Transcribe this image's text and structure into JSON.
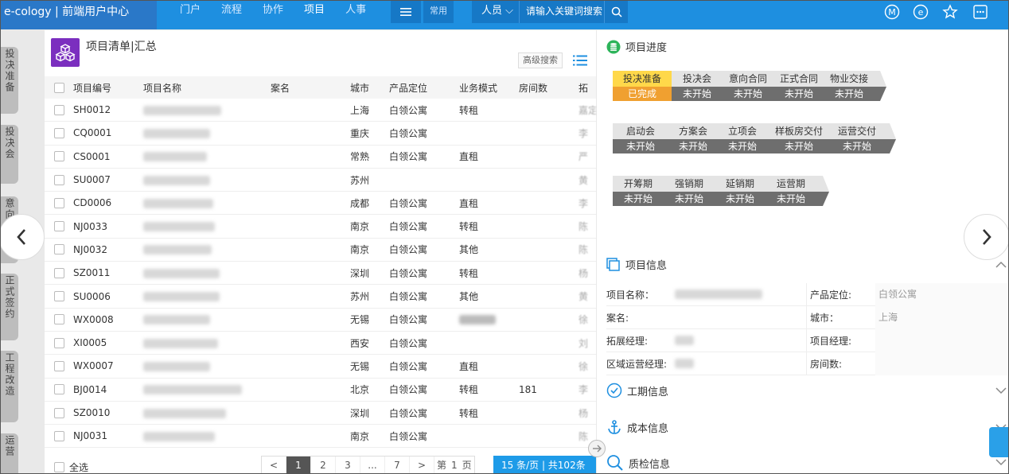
{
  "topbar": {
    "brand": "e-cology | 前端用户中心",
    "nav": [
      "门户",
      "流程",
      "协作",
      "项目",
      "人事"
    ],
    "active_nav": "项目",
    "common": "常用",
    "search_scope": "人员",
    "search_placeholder": "请输入关键词搜索"
  },
  "rail_tabs": [
    {
      "label": "投决准备"
    },
    {
      "label": "投决会"
    },
    {
      "label": "意向签约"
    },
    {
      "label": "正式签约"
    },
    {
      "label": "工程改造"
    },
    {
      "label": "运营"
    }
  ],
  "left": {
    "title": "项目清单|汇总",
    "adv_search": "高级搜索",
    "headers": [
      "项目编号",
      "项目名称",
      "案名",
      "城市",
      "产品定位",
      "业务模式",
      "房间数",
      "拓"
    ],
    "rows": [
      {
        "code": "SH0012",
        "city": "上海",
        "prod": "白领公寓",
        "mode": "转租",
        "rooms": "",
        "ext": "嘉定"
      },
      {
        "code": "CQ0001",
        "city": "重庆",
        "prod": "白领公寓",
        "mode": "",
        "rooms": "",
        "ext": "李"
      },
      {
        "code": "CS0001",
        "city": "常熟",
        "prod": "白领公寓",
        "mode": "直租",
        "rooms": "",
        "ext": "严"
      },
      {
        "code": "SU0007",
        "city": "苏州",
        "prod": "",
        "mode": "",
        "rooms": "",
        "ext": "黄"
      },
      {
        "code": "CD0006",
        "city": "成都",
        "prod": "白领公寓",
        "mode": "直租",
        "rooms": "",
        "ext": "李"
      },
      {
        "code": "NJ0033",
        "city": "南京",
        "prod": "白领公寓",
        "mode": "转租",
        "rooms": "",
        "ext": "陈"
      },
      {
        "code": "NJ0032",
        "city": "南京",
        "prod": "白领公寓",
        "mode": "其他",
        "rooms": "",
        "ext": "陈"
      },
      {
        "code": "SZ0011",
        "city": "深圳",
        "prod": "白领公寓",
        "mode": "转租",
        "rooms": "",
        "ext": "杨"
      },
      {
        "code": "SU0006",
        "city": "苏州",
        "prod": "白领公寓",
        "mode": "其他",
        "rooms": "",
        "ext": "黄"
      },
      {
        "code": "WX0008",
        "city": "无锡",
        "prod": "白领公寓",
        "mode": "",
        "rooms": "",
        "ext": "徐"
      },
      {
        "code": "XI0005",
        "city": "西安",
        "prod": "白领公寓",
        "mode": "",
        "rooms": "",
        "ext": "刘"
      },
      {
        "code": "WX0007",
        "city": "无锡",
        "prod": "白领公寓",
        "mode": "直租",
        "rooms": "",
        "ext": "徐"
      },
      {
        "code": "BJ0014",
        "city": "北京",
        "prod": "白领公寓",
        "mode": "转租",
        "rooms": "181",
        "ext": "李"
      },
      {
        "code": "SZ0010",
        "city": "深圳",
        "prod": "白领公寓",
        "mode": "转租",
        "rooms": "",
        "ext": "杨"
      },
      {
        "code": "NJ0031",
        "city": "南京",
        "prod": "白领公寓",
        "mode": "",
        "rooms": "",
        "ext": "陈"
      }
    ],
    "select_all": "全选",
    "pager": {
      "prev": "<",
      "pages": [
        "1",
        "2",
        "3",
        "...",
        "7"
      ],
      "next": ">",
      "goto_prefix": "第",
      "goto_value": "1",
      "goto_suffix": "页",
      "per_page": "15  条/页 | 共102条"
    }
  },
  "right": {
    "progress_title": "项目进度",
    "stage_rows": [
      [
        {
          "name": "投决准备",
          "status": "已完成",
          "done": true
        },
        {
          "name": "投决会",
          "status": "未开始",
          "done": false
        },
        {
          "name": "意向合同",
          "status": "未开始",
          "done": false
        },
        {
          "name": "正式合同",
          "status": "未开始",
          "done": false
        },
        {
          "name": "物业交接",
          "status": "未开始",
          "done": false
        }
      ],
      [
        {
          "name": "启动会",
          "status": "未开始",
          "done": false
        },
        {
          "name": "方案会",
          "status": "未开始",
          "done": false
        },
        {
          "name": "立项会",
          "status": "未开始",
          "done": false
        },
        {
          "name": "样板房交付",
          "status": "未开始",
          "done": false
        },
        {
          "name": "运营交付",
          "status": "未开始",
          "done": false
        }
      ],
      [
        {
          "name": "开筹期",
          "status": "未开始",
          "done": false
        },
        {
          "name": "强销期",
          "status": "未开始",
          "done": false
        },
        {
          "name": "延销期",
          "status": "未开始",
          "done": false
        },
        {
          "name": "运营期",
          "status": "未开始",
          "done": false
        }
      ]
    ],
    "info_title": "项目信息",
    "info": [
      {
        "l1": "项目名称：",
        "v1": "",
        "l2": "产品定位:",
        "v2": "白领公寓"
      },
      {
        "l1": "案名:",
        "v1": "",
        "l2": "城市：",
        "v2": "上海"
      },
      {
        "l1": "拓展经理:",
        "v1": "",
        "l2": "项目经理:",
        "v2": ""
      },
      {
        "l1": "区域运营经理:",
        "v1": "",
        "l2": "房间数:",
        "v2": ""
      }
    ],
    "schedule_title": "工期信息",
    "cost_title": "成本信息",
    "quality_title": "质检信息"
  },
  "colors": {
    "topbar": "#1e8fe0",
    "accent": "#1e9be8",
    "done_top": "#ffd84a",
    "done_bottom": "#f0a030",
    "pending_bottom": "#6e6e6e"
  }
}
